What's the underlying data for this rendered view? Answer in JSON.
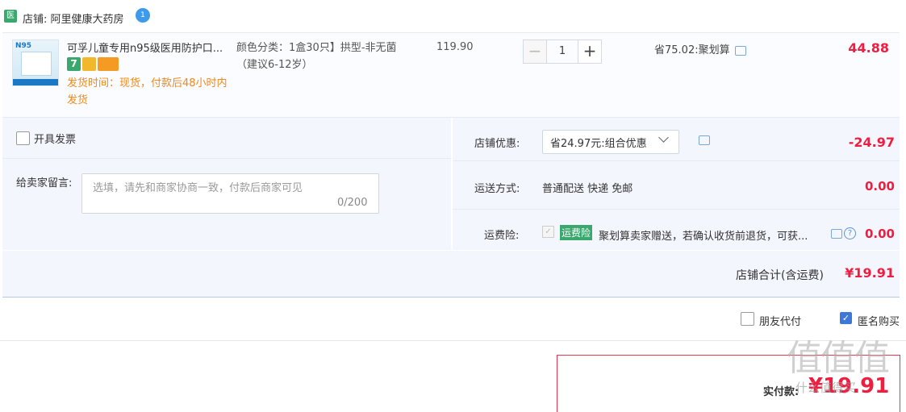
{
  "store": {
    "icon": "医",
    "label": "店铺: 阿里健康大药房",
    "badge": "1"
  },
  "item": {
    "title": "可孚儿童专用n95级医用防护口...",
    "thumb_text": "N95",
    "tag_seven": "7",
    "shipping": "发货时间：现货，付款后48小时内发货",
    "spec": "颜色分类：1盒30只】拱型-非无菌（建议6-12岁）",
    "price": "119.90",
    "qty_minus": "−",
    "quantity": "1",
    "qty_plus": "+",
    "saving": "省75.02:聚划算",
    "total": "44.88"
  },
  "invoice": {
    "label": "开具发票"
  },
  "message": {
    "label": "给卖家留言:",
    "placeholder": "选填，请先和商家协商一致，付款后商家可见",
    "count": "0/200"
  },
  "discount": {
    "label": "店铺优惠:",
    "selected": "省24.97元:组合优惠",
    "value": "-24.97"
  },
  "delivery": {
    "label": "运送方式:",
    "value": "普通配送 快递 免邮",
    "amount": "0.00"
  },
  "insurance": {
    "label": "运费险:",
    "check": "✓",
    "badge": "运费险",
    "text": "聚划算卖家赠送，若确认收货前退货，可获...",
    "help": "?",
    "amount": "0.00"
  },
  "summary": {
    "label": "店铺合计(含运费)",
    "value": "¥19.91"
  },
  "options": {
    "friend_pay": "朋友代付",
    "anonymous": "匿名购买",
    "anon_check": "✓"
  },
  "payment": {
    "label": "实付款:",
    "value": "¥19.91"
  },
  "watermark": {
    "big": "值值值",
    "small": "什么值得买"
  }
}
